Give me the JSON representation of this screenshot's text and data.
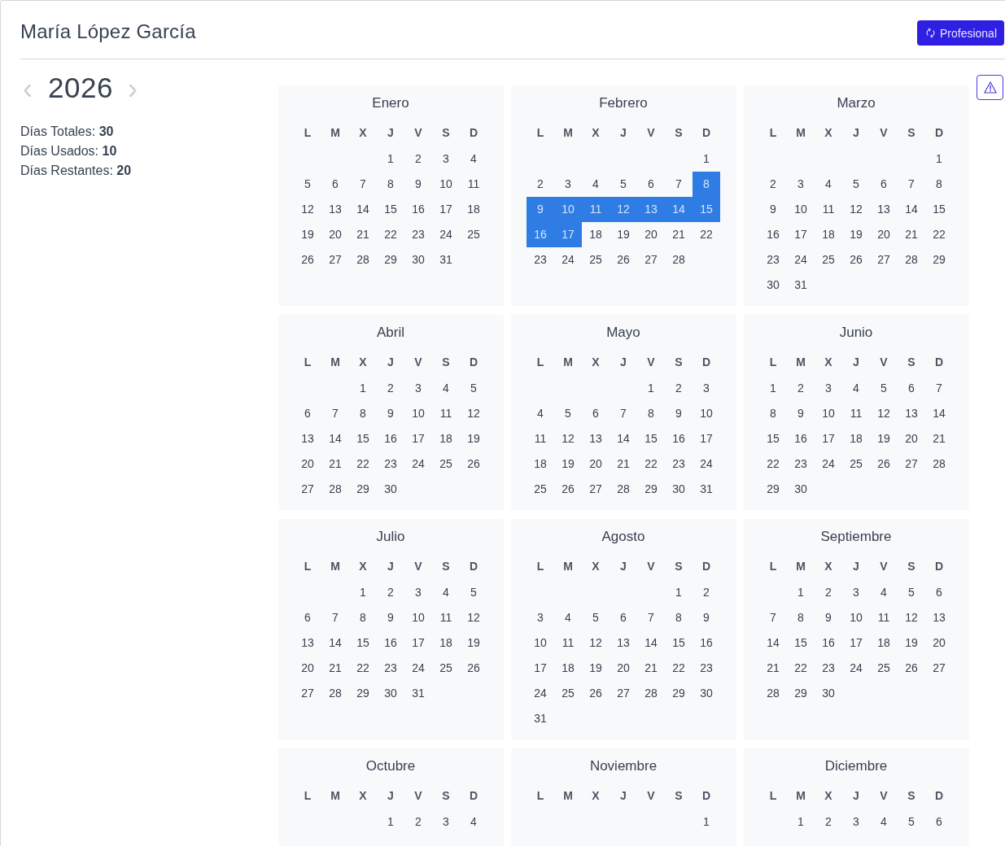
{
  "header": {
    "title": "María López García",
    "profile_button": "Profesional"
  },
  "year_nav": {
    "year": "2026"
  },
  "stats": [
    "Días Totales: **30**",
    "Días Usados: **10**",
    "Días Restantes: **20**"
  ],
  "months": [
    {
      "name": "Enero",
      "weekdays": [
        "L",
        "M",
        "X",
        "J",
        "V",
        "S",
        "D"
      ],
      "weeks": [
        [
          {
            "day": "1",
            "selected": false
          },
          {
            "day": "2",
            "selected": false
          },
          {
            "day": "3",
            "selected": false
          },
          {
            "day": "4",
            "selected": false
          }
        ],
        [
          {
            "day": "5",
            "selected": false
          },
          {
            "day": "6",
            "selected": false
          },
          {
            "day": "7",
            "selected": false
          },
          {
            "day": "8",
            "selected": false
          },
          {
            "day": "9",
            "selected": false
          },
          {
            "day": "10",
            "selected": false
          },
          {
            "day": "11",
            "selected": false
          }
        ],
        [
          {
            "day": "12",
            "selected": false
          },
          {
            "day": "13",
            "selected": false
          },
          {
            "day": "14",
            "selected": false
          },
          {
            "day": "15",
            "selected": false
          },
          {
            "day": "16",
            "selected": false
          },
          {
            "day": "17",
            "selected": false
          },
          {
            "day": "18",
            "selected": false
          }
        ],
        [
          {
            "day": "19",
            "selected": false
          },
          {
            "day": "20",
            "selected": false
          },
          {
            "day": "21",
            "selected": false
          },
          {
            "day": "22",
            "selected": false
          },
          {
            "day": "23",
            "selected": false
          },
          {
            "day": "24",
            "selected": false
          },
          {
            "day": "25",
            "selected": false
          }
        ],
        [
          {
            "day": "26",
            "selected": false
          },
          {
            "day": "27",
            "selected": false
          },
          {
            "day": "28",
            "selected": false
          },
          {
            "day": "29",
            "selected": false
          },
          {
            "day": "30",
            "selected": false
          },
          {
            "day": "31",
            "selected": false
          }
        ]
      ]
    },
    {
      "name": "Febrero",
      "weekdays": [
        "L",
        "M",
        "X",
        "J",
        "V",
        "S",
        "D"
      ],
      "weeks": [
        [
          {
            "day": "1",
            "selected": false
          }
        ],
        [
          {
            "day": "2",
            "selected": false
          },
          {
            "day": "3",
            "selected": false
          },
          {
            "day": "4",
            "selected": false
          },
          {
            "day": "5",
            "selected": false
          },
          {
            "day": "6",
            "selected": false
          },
          {
            "day": "7",
            "selected": false
          },
          {
            "day": "8",
            "selected": true
          }
        ],
        [
          {
            "day": "9",
            "selected": true
          },
          {
            "day": "10",
            "selected": true
          },
          {
            "day": "11",
            "selected": true
          },
          {
            "day": "12",
            "selected": true
          },
          {
            "day": "13",
            "selected": true
          },
          {
            "day": "14",
            "selected": true
          },
          {
            "day": "15",
            "selected": true
          }
        ],
        [
          {
            "day": "16",
            "selected": true
          },
          {
            "day": "17",
            "selected": true
          },
          {
            "day": "18",
            "selected": false
          },
          {
            "day": "19",
            "selected": false
          },
          {
            "day": "20",
            "selected": false
          },
          {
            "day": "21",
            "selected": false
          },
          {
            "day": "22",
            "selected": false
          }
        ],
        [
          {
            "day": "23",
            "selected": false
          },
          {
            "day": "24",
            "selected": false
          },
          {
            "day": "25",
            "selected": false
          },
          {
            "day": "26",
            "selected": false
          },
          {
            "day": "27",
            "selected": false
          },
          {
            "day": "28",
            "selected": false
          }
        ]
      ]
    },
    {
      "name": "Marzo",
      "weekdays": [
        "L",
        "M",
        "X",
        "J",
        "V",
        "S",
        "D"
      ],
      "weeks": [
        [
          {
            "day": "1",
            "selected": false
          }
        ],
        [
          {
            "day": "2",
            "selected": false
          },
          {
            "day": "3",
            "selected": false
          },
          {
            "day": "4",
            "selected": false
          },
          {
            "day": "5",
            "selected": false
          },
          {
            "day": "6",
            "selected": false
          },
          {
            "day": "7",
            "selected": false
          },
          {
            "day": "8",
            "selected": false
          }
        ],
        [
          {
            "day": "9",
            "selected": false
          },
          {
            "day": "10",
            "selected": false
          },
          {
            "day": "11",
            "selected": false
          },
          {
            "day": "12",
            "selected": false
          },
          {
            "day": "13",
            "selected": false
          },
          {
            "day": "14",
            "selected": false
          },
          {
            "day": "15",
            "selected": false
          }
        ],
        [
          {
            "day": "16",
            "selected": false
          },
          {
            "day": "17",
            "selected": false
          },
          {
            "day": "18",
            "selected": false
          },
          {
            "day": "19",
            "selected": false
          },
          {
            "day": "20",
            "selected": false
          },
          {
            "day": "21",
            "selected": false
          },
          {
            "day": "22",
            "selected": false
          }
        ],
        [
          {
            "day": "23",
            "selected": false
          },
          {
            "day": "24",
            "selected": false
          },
          {
            "day": "25",
            "selected": false
          },
          {
            "day": "26",
            "selected": false
          },
          {
            "day": "27",
            "selected": false
          },
          {
            "day": "28",
            "selected": false
          },
          {
            "day": "29",
            "selected": false
          }
        ],
        [
          {
            "day": "30",
            "selected": false
          },
          {
            "day": "31",
            "selected": false
          }
        ]
      ]
    },
    {
      "name": "Abril",
      "weekdays": [
        "L",
        "M",
        "X",
        "J",
        "V",
        "S",
        "D"
      ],
      "weeks": [
        [
          {
            "day": "1",
            "selected": false
          },
          {
            "day": "2",
            "selected": false
          },
          {
            "day": "3",
            "selected": false
          },
          {
            "day": "4",
            "selected": false
          },
          {
            "day": "5",
            "selected": false
          }
        ],
        [
          {
            "day": "6",
            "selected": false
          },
          {
            "day": "7",
            "selected": false
          },
          {
            "day": "8",
            "selected": false
          },
          {
            "day": "9",
            "selected": false
          },
          {
            "day": "10",
            "selected": false
          },
          {
            "day": "11",
            "selected": false
          },
          {
            "day": "12",
            "selected": false
          }
        ],
        [
          {
            "day": "13",
            "selected": false
          },
          {
            "day": "14",
            "selected": false
          },
          {
            "day": "15",
            "selected": false
          },
          {
            "day": "16",
            "selected": false
          },
          {
            "day": "17",
            "selected": false
          },
          {
            "day": "18",
            "selected": false
          },
          {
            "day": "19",
            "selected": false
          }
        ],
        [
          {
            "day": "20",
            "selected": false
          },
          {
            "day": "21",
            "selected": false
          },
          {
            "day": "22",
            "selected": false
          },
          {
            "day": "23",
            "selected": false
          },
          {
            "day": "24",
            "selected": false
          },
          {
            "day": "25",
            "selected": false
          },
          {
            "day": "26",
            "selected": false
          }
        ],
        [
          {
            "day": "27",
            "selected": false
          },
          {
            "day": "28",
            "selected": false
          },
          {
            "day": "29",
            "selected": false
          },
          {
            "day": "30",
            "selected": false
          }
        ]
      ]
    },
    {
      "name": "Mayo",
      "weekdays": [
        "L",
        "M",
        "X",
        "J",
        "V",
        "S",
        "D"
      ],
      "weeks": [
        [
          {
            "day": "1",
            "selected": false
          },
          {
            "day": "2",
            "selected": false
          },
          {
            "day": "3",
            "selected": false
          }
        ],
        [
          {
            "day": "4",
            "selected": false
          },
          {
            "day": "5",
            "selected": false
          },
          {
            "day": "6",
            "selected": false
          },
          {
            "day": "7",
            "selected": false
          },
          {
            "day": "8",
            "selected": false
          },
          {
            "day": "9",
            "selected": false
          },
          {
            "day": "10",
            "selected": false
          }
        ],
        [
          {
            "day": "11",
            "selected": false
          },
          {
            "day": "12",
            "selected": false
          },
          {
            "day": "13",
            "selected": false
          },
          {
            "day": "14",
            "selected": false
          },
          {
            "day": "15",
            "selected": false
          },
          {
            "day": "16",
            "selected": false
          },
          {
            "day": "17",
            "selected": false
          }
        ],
        [
          {
            "day": "18",
            "selected": false
          },
          {
            "day": "19",
            "selected": false
          },
          {
            "day": "20",
            "selected": false
          },
          {
            "day": "21",
            "selected": false
          },
          {
            "day": "22",
            "selected": false
          },
          {
            "day": "23",
            "selected": false
          },
          {
            "day": "24",
            "selected": false
          }
        ],
        [
          {
            "day": "25",
            "selected": false
          },
          {
            "day": "26",
            "selected": false
          },
          {
            "day": "27",
            "selected": false
          },
          {
            "day": "28",
            "selected": false
          },
          {
            "day": "29",
            "selected": false
          },
          {
            "day": "30",
            "selected": false
          },
          {
            "day": "31",
            "selected": false
          }
        ]
      ]
    },
    {
      "name": "Junio",
      "weekdays": [
        "L",
        "M",
        "X",
        "J",
        "V",
        "S",
        "D"
      ],
      "weeks": [
        [
          {
            "day": "1",
            "selected": false
          },
          {
            "day": "2",
            "selected": false
          },
          {
            "day": "3",
            "selected": false
          },
          {
            "day": "4",
            "selected": false
          },
          {
            "day": "5",
            "selected": false
          },
          {
            "day": "6",
            "selected": false
          },
          {
            "day": "7",
            "selected": false
          }
        ],
        [
          {
            "day": "8",
            "selected": false
          },
          {
            "day": "9",
            "selected": false
          },
          {
            "day": "10",
            "selected": false
          },
          {
            "day": "11",
            "selected": false
          },
          {
            "day": "12",
            "selected": false
          },
          {
            "day": "13",
            "selected": false
          },
          {
            "day": "14",
            "selected": false
          }
        ],
        [
          {
            "day": "15",
            "selected": false
          },
          {
            "day": "16",
            "selected": false
          },
          {
            "day": "17",
            "selected": false
          },
          {
            "day": "18",
            "selected": false
          },
          {
            "day": "19",
            "selected": false
          },
          {
            "day": "20",
            "selected": false
          },
          {
            "day": "21",
            "selected": false
          }
        ],
        [
          {
            "day": "22",
            "selected": false
          },
          {
            "day": "23",
            "selected": false
          },
          {
            "day": "24",
            "selected": false
          },
          {
            "day": "25",
            "selected": false
          },
          {
            "day": "26",
            "selected": false
          },
          {
            "day": "27",
            "selected": false
          },
          {
            "day": "28",
            "selected": false
          }
        ],
        [
          {
            "day": "29",
            "selected": false
          },
          {
            "day": "30",
            "selected": false
          }
        ]
      ]
    },
    {
      "name": "Julio",
      "weekdays": [
        "L",
        "M",
        "X",
        "J",
        "V",
        "S",
        "D"
      ],
      "weeks": [
        [
          {
            "day": "1",
            "selected": false
          },
          {
            "day": "2",
            "selected": false
          },
          {
            "day": "3",
            "selected": false
          },
          {
            "day": "4",
            "selected": false
          },
          {
            "day": "5",
            "selected": false
          }
        ],
        [
          {
            "day": "6",
            "selected": false
          },
          {
            "day": "7",
            "selected": false
          },
          {
            "day": "8",
            "selected": false
          },
          {
            "day": "9",
            "selected": false
          },
          {
            "day": "10",
            "selected": false
          },
          {
            "day": "11",
            "selected": false
          },
          {
            "day": "12",
            "selected": false
          }
        ],
        [
          {
            "day": "13",
            "selected": false
          },
          {
            "day": "14",
            "selected": false
          },
          {
            "day": "15",
            "selected": false
          },
          {
            "day": "16",
            "selected": false
          },
          {
            "day": "17",
            "selected": false
          },
          {
            "day": "18",
            "selected": false
          },
          {
            "day": "19",
            "selected": false
          }
        ],
        [
          {
            "day": "20",
            "selected": false
          },
          {
            "day": "21",
            "selected": false
          },
          {
            "day": "22",
            "selected": false
          },
          {
            "day": "23",
            "selected": false
          },
          {
            "day": "24",
            "selected": false
          },
          {
            "day": "25",
            "selected": false
          },
          {
            "day": "26",
            "selected": false
          }
        ],
        [
          {
            "day": "27",
            "selected": false
          },
          {
            "day": "28",
            "selected": false
          },
          {
            "day": "29",
            "selected": false
          },
          {
            "day": "30",
            "selected": false
          },
          {
            "day": "31",
            "selected": false
          }
        ]
      ]
    },
    {
      "name": "Agosto",
      "weekdays": [
        "L",
        "M",
        "X",
        "J",
        "V",
        "S",
        "D"
      ],
      "weeks": [
        [
          {
            "day": "1",
            "selected": false
          },
          {
            "day": "2",
            "selected": false
          }
        ],
        [
          {
            "day": "3",
            "selected": false
          },
          {
            "day": "4",
            "selected": false
          },
          {
            "day": "5",
            "selected": false
          },
          {
            "day": "6",
            "selected": false
          },
          {
            "day": "7",
            "selected": false
          },
          {
            "day": "8",
            "selected": false
          },
          {
            "day": "9",
            "selected": false
          }
        ],
        [
          {
            "day": "10",
            "selected": false
          },
          {
            "day": "11",
            "selected": false
          },
          {
            "day": "12",
            "selected": false
          },
          {
            "day": "13",
            "selected": false
          },
          {
            "day": "14",
            "selected": false
          },
          {
            "day": "15",
            "selected": false
          },
          {
            "day": "16",
            "selected": false
          }
        ],
        [
          {
            "day": "17",
            "selected": false
          },
          {
            "day": "18",
            "selected": false
          },
          {
            "day": "19",
            "selected": false
          },
          {
            "day": "20",
            "selected": false
          },
          {
            "day": "21",
            "selected": false
          },
          {
            "day": "22",
            "selected": false
          },
          {
            "day": "23",
            "selected": false
          }
        ],
        [
          {
            "day": "24",
            "selected": false
          },
          {
            "day": "25",
            "selected": false
          },
          {
            "day": "26",
            "selected": false
          },
          {
            "day": "27",
            "selected": false
          },
          {
            "day": "28",
            "selected": false
          },
          {
            "day": "29",
            "selected": false
          },
          {
            "day": "30",
            "selected": false
          }
        ],
        [
          {
            "day": "31",
            "selected": false
          }
        ]
      ]
    },
    {
      "name": "Septiembre",
      "weekdays": [
        "L",
        "M",
        "X",
        "J",
        "V",
        "S",
        "D"
      ],
      "weeks": [
        [
          {
            "day": "1",
            "selected": false
          },
          {
            "day": "2",
            "selected": false
          },
          {
            "day": "3",
            "selected": false
          },
          {
            "day": "4",
            "selected": false
          },
          {
            "day": "5",
            "selected": false
          },
          {
            "day": "6",
            "selected": false
          }
        ],
        [
          {
            "day": "7",
            "selected": false
          },
          {
            "day": "8",
            "selected": false
          },
          {
            "day": "9",
            "selected": false
          },
          {
            "day": "10",
            "selected": false
          },
          {
            "day": "11",
            "selected": false
          },
          {
            "day": "12",
            "selected": false
          },
          {
            "day": "13",
            "selected": false
          }
        ],
        [
          {
            "day": "14",
            "selected": false
          },
          {
            "day": "15",
            "selected": false
          },
          {
            "day": "16",
            "selected": false
          },
          {
            "day": "17",
            "selected": false
          },
          {
            "day": "18",
            "selected": false
          },
          {
            "day": "19",
            "selected": false
          },
          {
            "day": "20",
            "selected": false
          }
        ],
        [
          {
            "day": "21",
            "selected": false
          },
          {
            "day": "22",
            "selected": false
          },
          {
            "day": "23",
            "selected": false
          },
          {
            "day": "24",
            "selected": false
          },
          {
            "day": "25",
            "selected": false
          },
          {
            "day": "26",
            "selected": false
          },
          {
            "day": "27",
            "selected": false
          }
        ],
        [
          {
            "day": "28",
            "selected": false
          },
          {
            "day": "29",
            "selected": false
          },
          {
            "day": "30",
            "selected": false
          }
        ]
      ]
    },
    {
      "name": "Octubre",
      "weekdays": [
        "L",
        "M",
        "X",
        "J",
        "V",
        "S",
        "D"
      ],
      "weeks": [
        [
          {
            "day": "1",
            "selected": false
          },
          {
            "day": "2",
            "selected": false
          },
          {
            "day": "3",
            "selected": false
          },
          {
            "day": "4",
            "selected": false
          }
        ]
      ]
    },
    {
      "name": "Noviembre",
      "weekdays": [
        "L",
        "M",
        "X",
        "J",
        "V",
        "S",
        "D"
      ],
      "weeks": [
        [
          {
            "day": "1",
            "selected": false
          }
        ]
      ]
    },
    {
      "name": "Diciembre",
      "weekdays": [
        "L",
        "M",
        "X",
        "J",
        "V",
        "S",
        "D"
      ],
      "weeks": [
        [
          {
            "day": "1",
            "selected": false
          },
          {
            "day": "2",
            "selected": false
          },
          {
            "day": "3",
            "selected": false
          },
          {
            "day": "4",
            "selected": false
          },
          {
            "day": "5",
            "selected": false
          },
          {
            "day": "6",
            "selected": false
          }
        ]
      ]
    }
  ]
}
